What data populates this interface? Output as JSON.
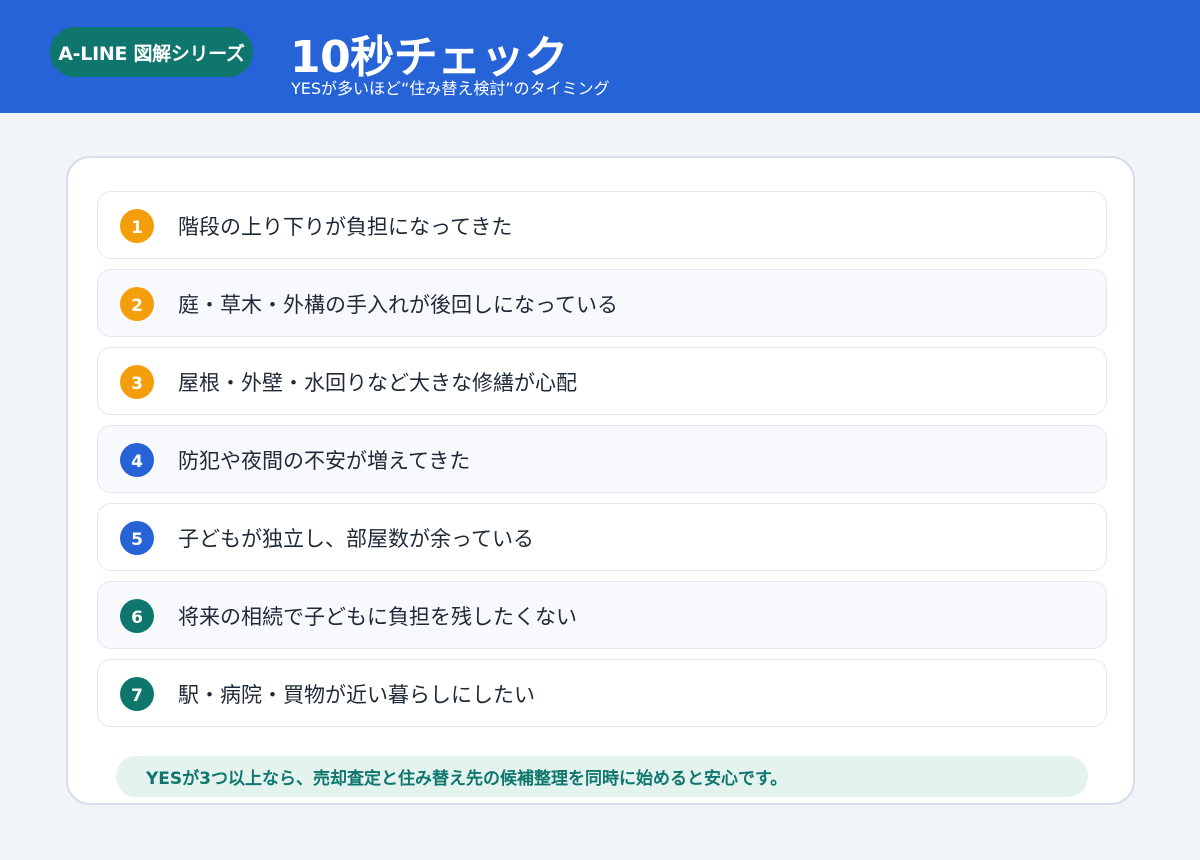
{
  "header": {
    "badge": "A-LINE 図解シリーズ",
    "title": "10秒チェック",
    "subtitle": "YESが多いほど“住み替え検討”のタイミング"
  },
  "checklist": {
    "items": [
      {
        "number": "1",
        "text": "階段の上り下りが負担になってきた",
        "color": "#f59e0b"
      },
      {
        "number": "2",
        "text": "庭・草木・外構の手入れが後回しになっている",
        "color": "#f59e0b"
      },
      {
        "number": "3",
        "text": "屋根・外壁・水回りなど大きな修繕が心配",
        "color": "#f59e0b"
      },
      {
        "number": "4",
        "text": "防犯や夜間の不安が増えてきた",
        "color": "#2563d6"
      },
      {
        "number": "5",
        "text": "子どもが独立し、部屋数が余っている",
        "color": "#2563d6"
      },
      {
        "number": "6",
        "text": "将来の相続で子どもに負担を残したくない",
        "color": "#0f766e"
      },
      {
        "number": "7",
        "text": "駅・病院・買物が近い暮らしにしたい",
        "color": "#0f766e"
      }
    ],
    "note": "YESが3つ以上なら、売却査定と住み替え先の候補整理を同時に始めると安心です。"
  },
  "colors": {
    "header_bg": "#2563d6",
    "badge_bg": "#0f766e",
    "note_bg": "#e5f3ef",
    "note_text": "#0f766e"
  }
}
